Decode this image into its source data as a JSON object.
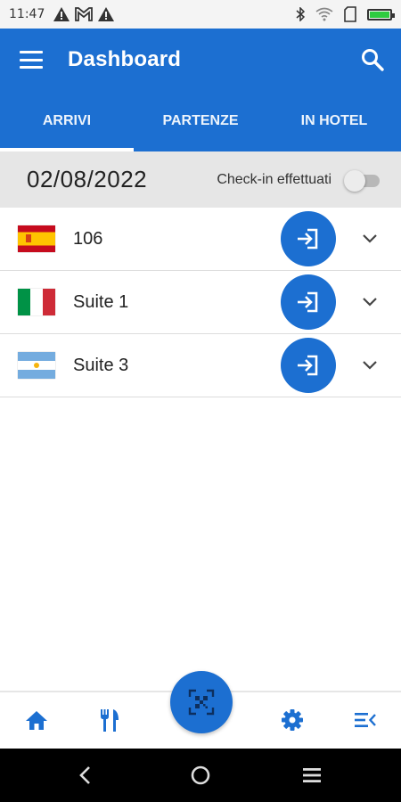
{
  "status_bar": {
    "time": "11:47",
    "left_icons": [
      "warning-icon",
      "gmail-icon",
      "warning-icon"
    ],
    "right_icons": [
      "bluetooth-icon",
      "wifi-icon",
      "sim-icon",
      "battery-icon"
    ],
    "battery_level": 1.0
  },
  "app_bar": {
    "title": "Dashboard",
    "tabs": [
      {
        "label": "ARRIVI",
        "active": true
      },
      {
        "label": "PARTENZE",
        "active": false
      },
      {
        "label": "IN HOTEL",
        "active": false
      }
    ]
  },
  "filter": {
    "date": "02/08/2022",
    "checkin_label": "Check-in effettuati",
    "checkin_toggle_on": false
  },
  "arrivals": [
    {
      "flag": "spain-flag-icon",
      "room": "106"
    },
    {
      "flag": "italy-flag-icon",
      "room": "Suite 1"
    },
    {
      "flag": "argentina-flag-icon",
      "room": "Suite 3"
    }
  ],
  "bottom_nav": {
    "items": [
      "home-icon",
      "restaurant-icon",
      "qr-scan-icon",
      "settings-icon",
      "menu-collapse-icon"
    ]
  },
  "colors": {
    "primary": "#1c6fd1",
    "date_row_bg": "#e6e6e6"
  }
}
